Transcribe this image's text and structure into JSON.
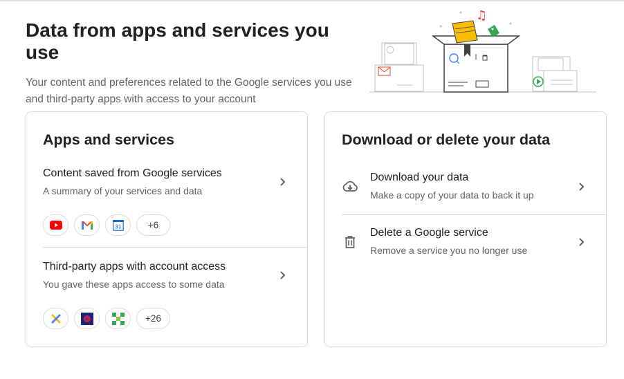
{
  "header": {
    "title": "Data from apps and services you use",
    "subtitle": "Your content and preferences related to the Google services you use and third-party apps with access to your account"
  },
  "apps_card": {
    "title": "Apps and services",
    "content_saved": {
      "title": "Content saved from Google services",
      "subtitle": "A summary of your services and data",
      "icons": [
        "youtube-icon",
        "gmail-icon",
        "calendar-icon"
      ],
      "more": "+6"
    },
    "third_party": {
      "title": "Third-party apps with account access",
      "subtitle": "You gave these apps access to some data",
      "icons": [
        "app-x-icon",
        "app-game-icon",
        "app-grid-icon"
      ],
      "more": "+26"
    }
  },
  "download_card": {
    "title": "Download or delete your data",
    "download": {
      "title": "Download your data",
      "subtitle": "Make a copy of your data to back it up",
      "icon": "cloud-download-icon"
    },
    "delete": {
      "title": "Delete a Google service",
      "subtitle": "Remove a service you no longer use",
      "icon": "trash-icon"
    }
  },
  "colors": {
    "border": "#dadce0",
    "text_primary": "#202124",
    "text_secondary": "#5f6368",
    "youtube_red": "#ff0000",
    "gmail_red": "#ea4335",
    "calendar_blue": "#4285f4"
  }
}
